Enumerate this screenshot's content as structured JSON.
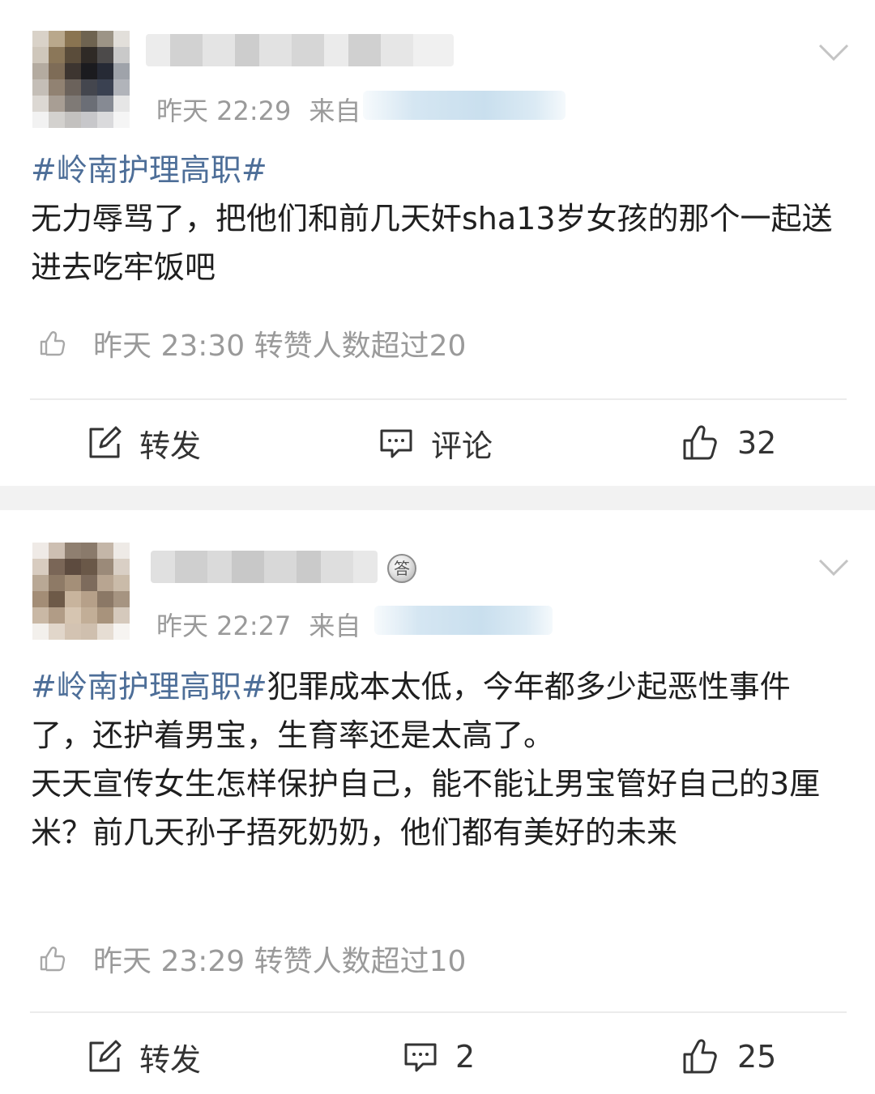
{
  "posts": [
    {
      "time": "昨天 22:29",
      "source_prefix": "来自",
      "hashtag": "#岭南护理高职#",
      "body": "无力辱骂了，把他们和前几天奸sha13岁女孩的那个一起送进去吃牢饭吧",
      "liked_text": "昨天 23:30 转赞人数超过20",
      "actions": {
        "repost": "转发",
        "comment": "评论",
        "like": "32"
      }
    },
    {
      "time": "昨天 22:27",
      "source_prefix": "来自",
      "hashtag": "#岭南护理高职#",
      "body": "犯罪成本太低，今年都多少起恶性事件了，还护着男宝，生育率还是太高了。",
      "body2": "天天宣传女生怎样保护自己，能不能让男宝管好自己的3厘米？前几天孙子捂死奶奶，他们都有美好的未来",
      "liked_text": "昨天 23:29 转赞人数超过10",
      "badge": "答",
      "actions": {
        "repost": "转发",
        "comment": "2",
        "like": "25"
      }
    }
  ],
  "icons": {
    "more": "chevron-down-icon",
    "liked": "thumbs-up-outline-icon",
    "repost": "share-edit-icon",
    "comment": "comment-bubble-icon",
    "like": "thumbs-up-icon"
  },
  "colors": {
    "hashtag": "#4d6e98",
    "meta": "#9a9a9a",
    "text": "#1f1f1f",
    "separator": "#f2f2f2"
  }
}
